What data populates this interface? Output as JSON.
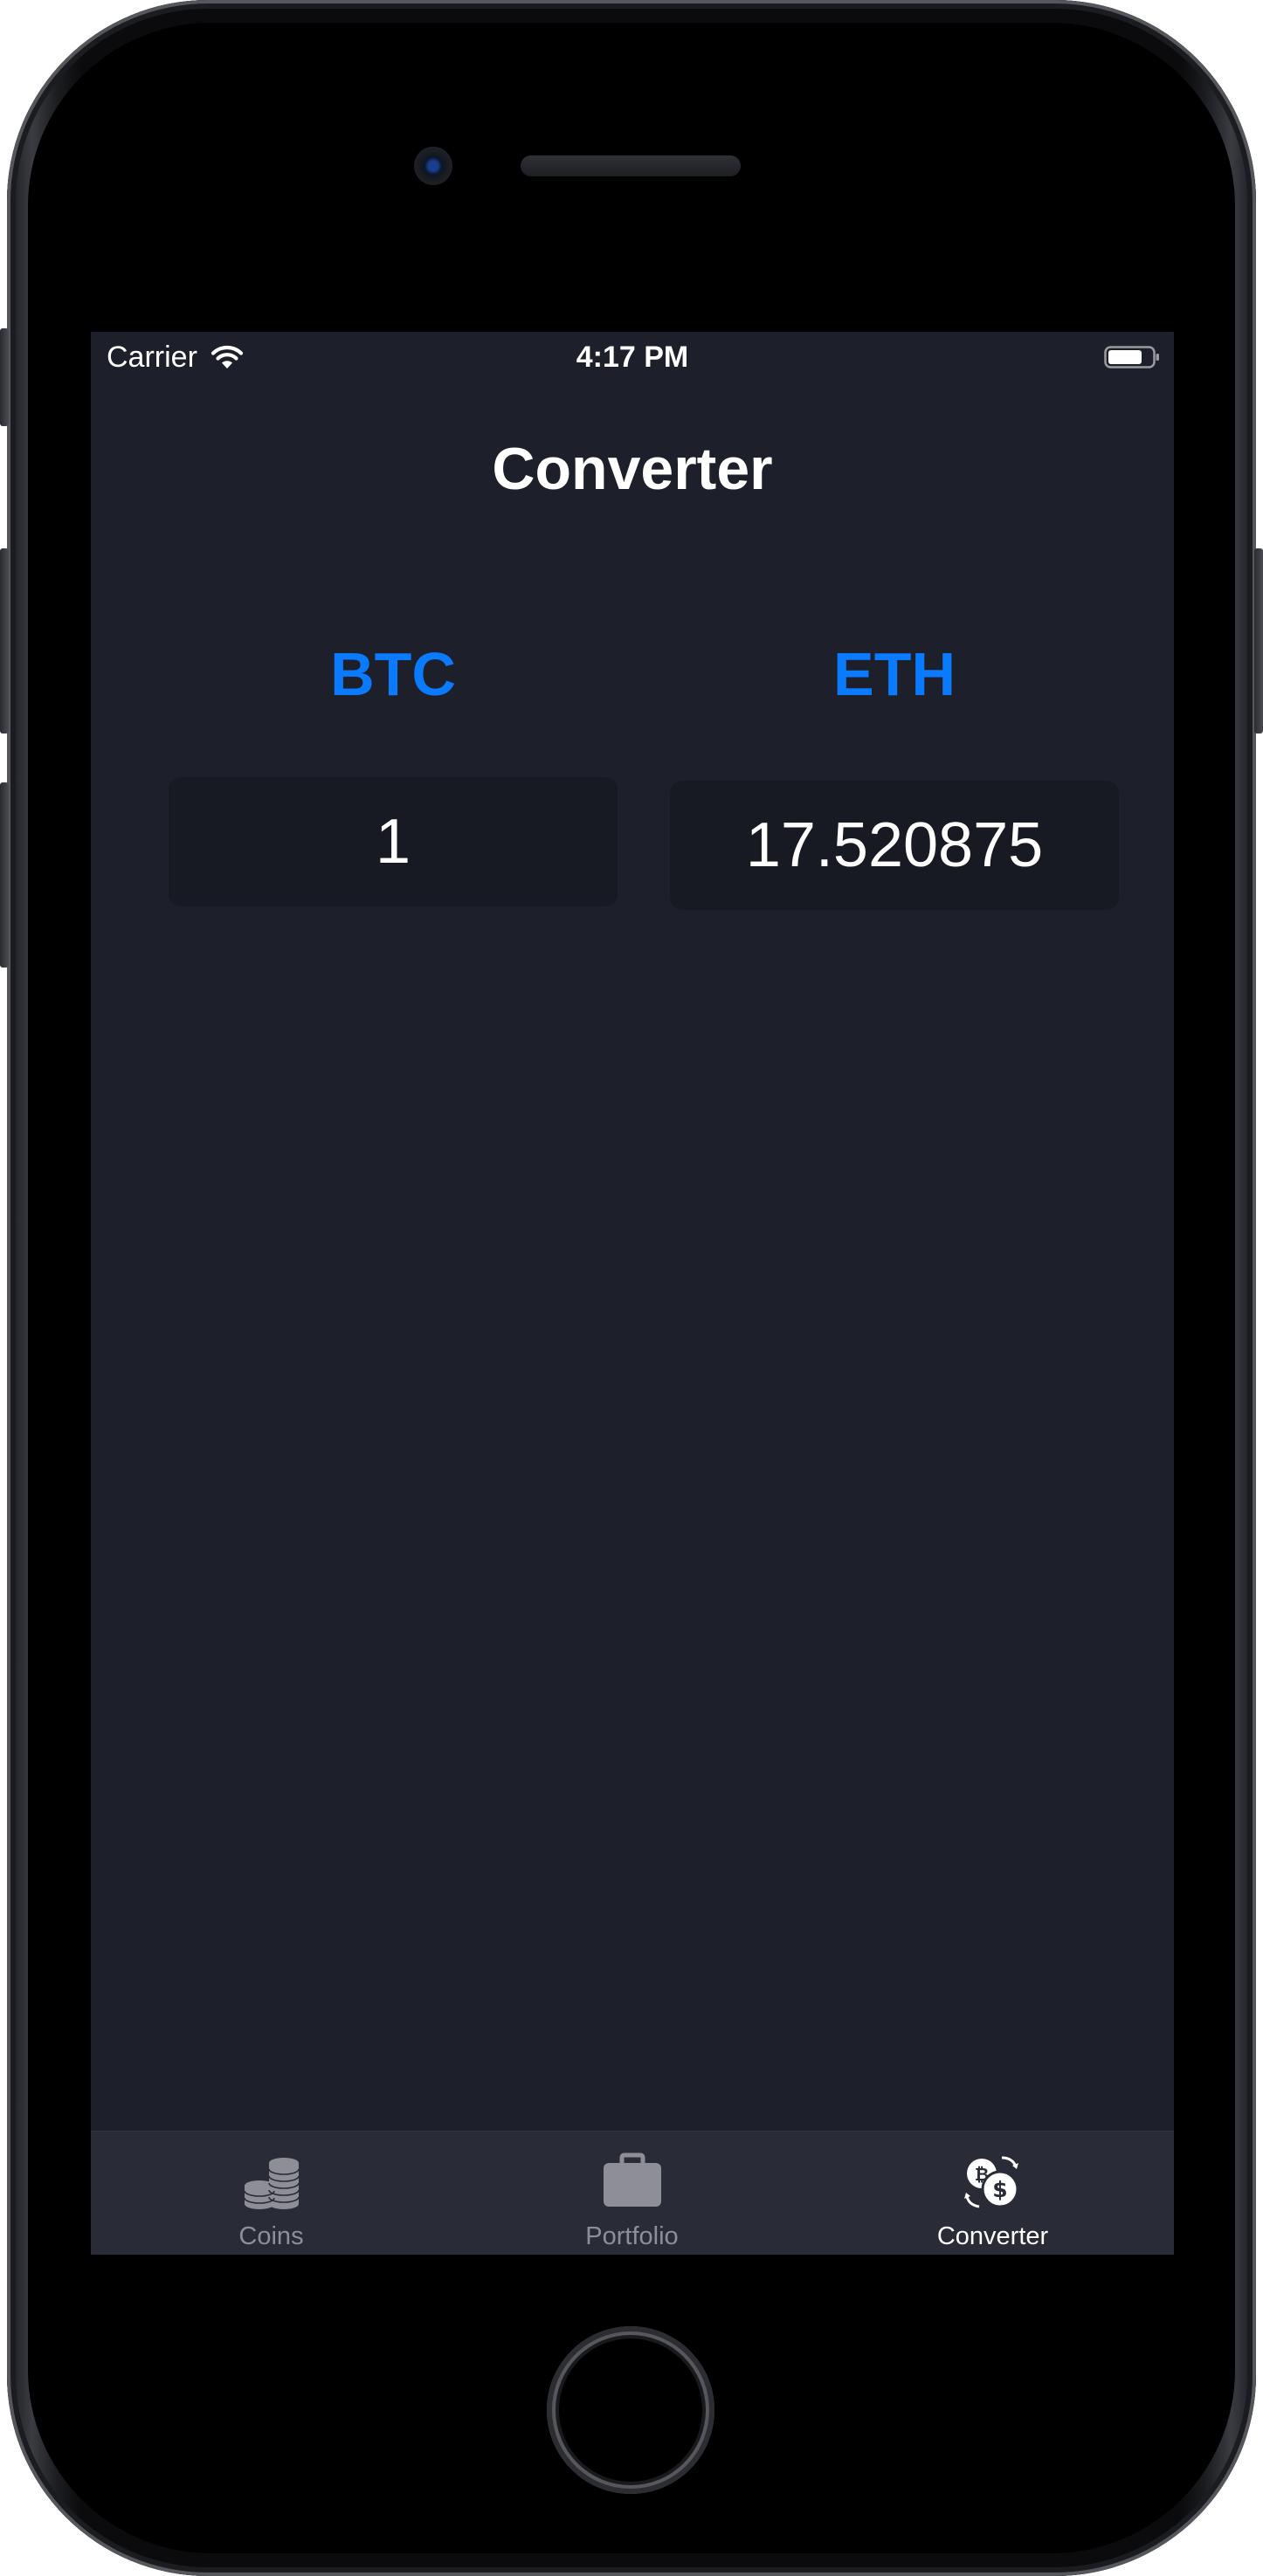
{
  "status_bar": {
    "carrier": "Carrier",
    "time": "4:17 PM",
    "wifi_icon": "wifi-icon",
    "battery_icon": "battery-icon"
  },
  "header": {
    "title": "Converter"
  },
  "converter": {
    "from_currency": "BTC",
    "to_currency": "ETH",
    "from_amount": "1",
    "to_amount": "17.520875",
    "accent_color": "#0a7aff"
  },
  "tab_bar": {
    "items": [
      {
        "label": "Coins",
        "icon": "coins-stack-icon",
        "selected": false
      },
      {
        "label": "Portfolio",
        "icon": "briefcase-icon",
        "selected": false
      },
      {
        "label": "Converter",
        "icon": "currency-exchange-icon",
        "selected": true
      }
    ],
    "selected_color": "#ffffff",
    "unselected_color": "#8e8f96"
  },
  "colors": {
    "background": "#1d202a",
    "field_background": "#171a22",
    "tab_bar_background": "#292c36"
  }
}
